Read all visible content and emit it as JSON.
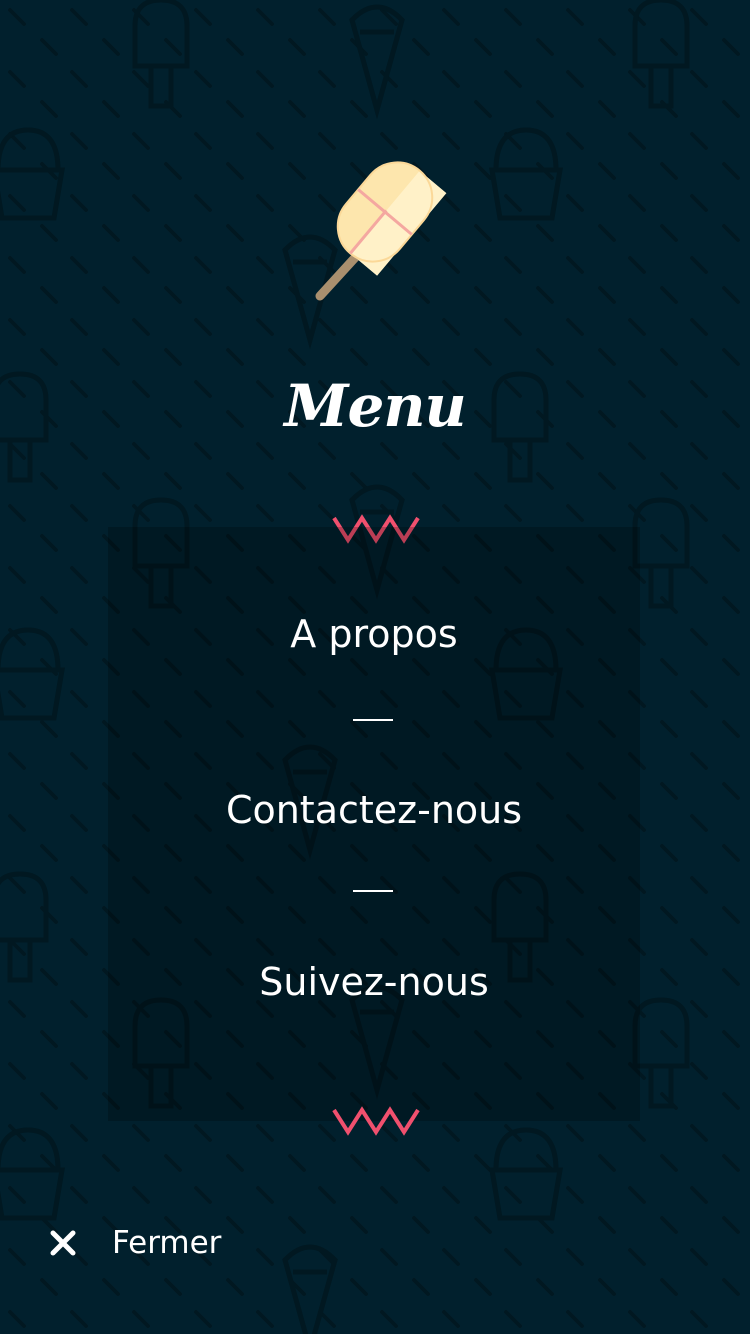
{
  "menu": {
    "title": "Menu",
    "items": [
      {
        "label": "A propos"
      },
      {
        "label": "Contactez-nous"
      },
      {
        "label": "Suivez-nous"
      }
    ]
  },
  "footer": {
    "close_label": "Fermer"
  },
  "icons": {
    "logo": "popsicle-icon",
    "decor": "zigzag-icon",
    "close": "close-icon"
  },
  "colors": {
    "background": "#01202d",
    "accent": "#f0506e",
    "text": "#ffffff",
    "panel": "rgba(0,0,0,0.22)"
  }
}
